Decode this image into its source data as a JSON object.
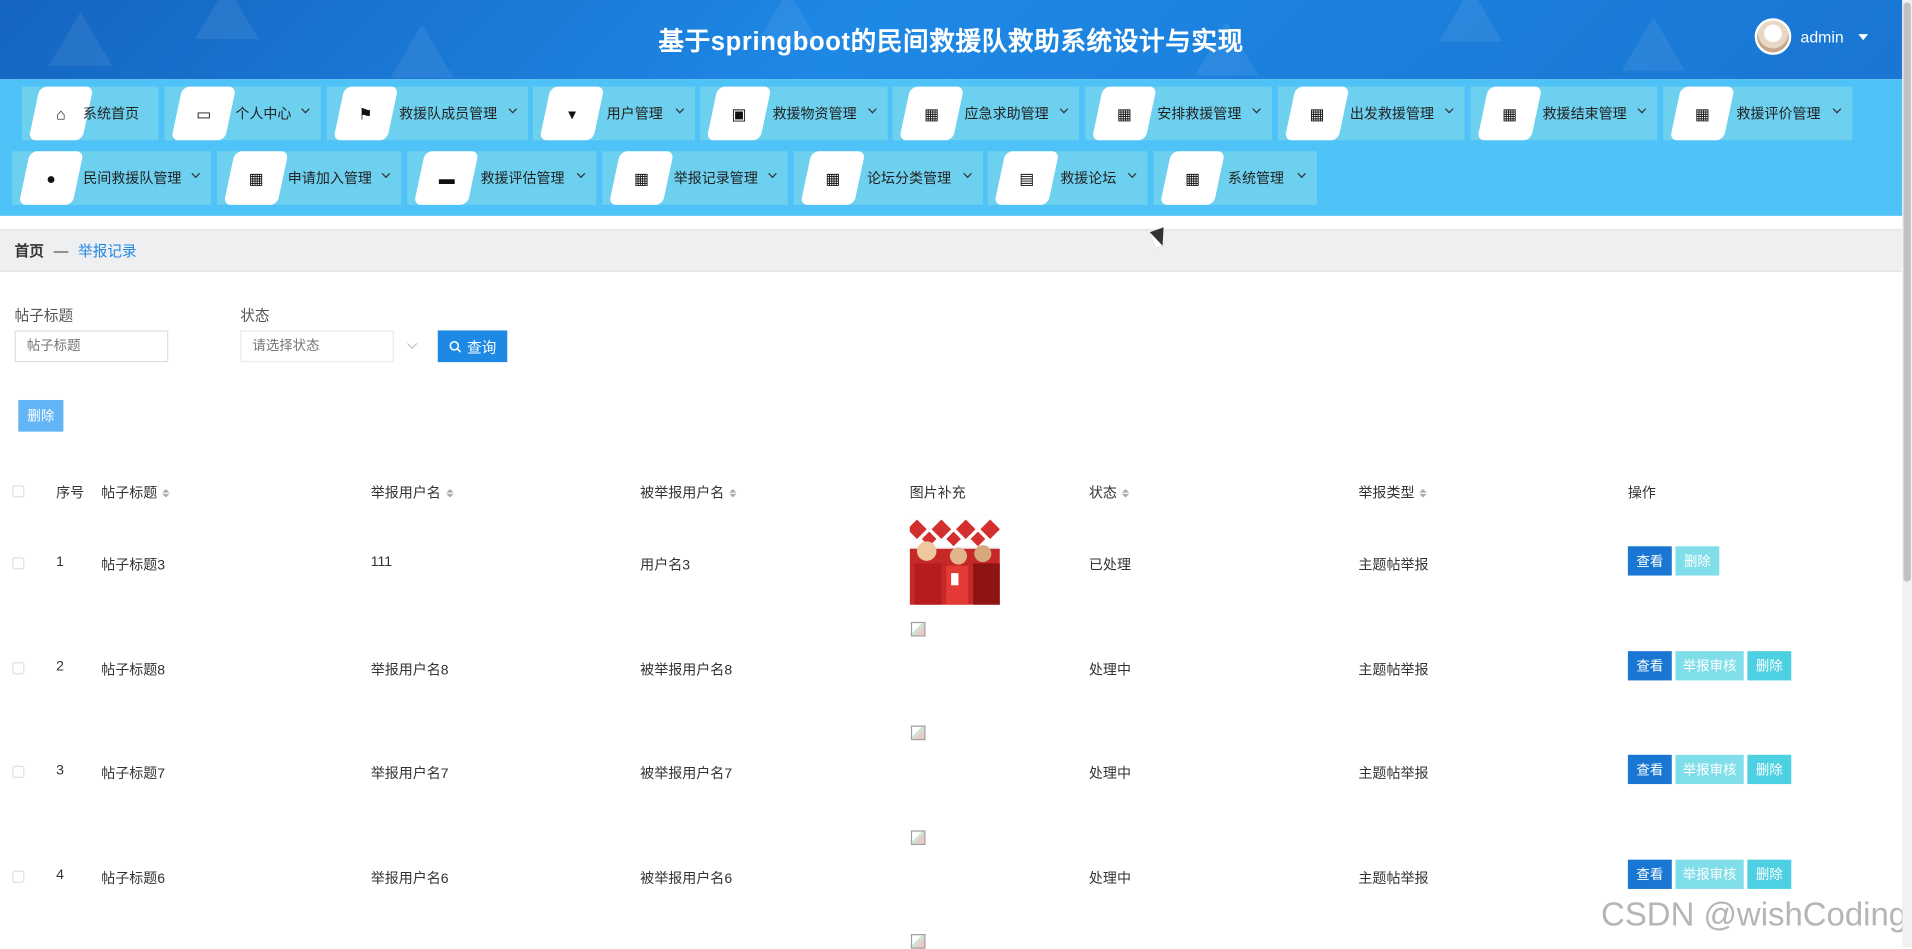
{
  "header": {
    "title": "基于springboot的民间救援队救助系统设计与实现",
    "user": "admin"
  },
  "nav": {
    "row1": [
      {
        "label": "系统首页",
        "icon": "home-icon",
        "glyph": "⌂",
        "dropdown": false
      },
      {
        "label": "个人中心",
        "icon": "card-icon",
        "glyph": "▭",
        "dropdown": true
      },
      {
        "label": "救援队成员管理",
        "icon": "flag-icon",
        "glyph": "⚑",
        "dropdown": true
      },
      {
        "label": "用户管理",
        "icon": "brush-icon",
        "glyph": "▾",
        "dropdown": true
      },
      {
        "label": "救援物资管理",
        "icon": "clipboard-icon",
        "glyph": "▣",
        "dropdown": true
      },
      {
        "label": "应急求助管理",
        "icon": "grid-icon",
        "glyph": "▦",
        "dropdown": true
      },
      {
        "label": "安排救援管理",
        "icon": "grid-icon",
        "glyph": "▦",
        "dropdown": true
      },
      {
        "label": "出发救援管理",
        "icon": "grid-icon",
        "glyph": "▦",
        "dropdown": true
      },
      {
        "label": "救援结束管理",
        "icon": "grid-icon",
        "glyph": "▦",
        "dropdown": true
      },
      {
        "label": "救援评价管理",
        "icon": "grid-icon",
        "glyph": "▦",
        "dropdown": true
      }
    ],
    "row2": [
      {
        "label": "民间救援队管理",
        "icon": "pin-icon",
        "glyph": "●",
        "dropdown": true
      },
      {
        "label": "申请加入管理",
        "icon": "grid-icon",
        "glyph": "▦",
        "dropdown": true
      },
      {
        "label": "救援评估管理",
        "icon": "monitor-icon",
        "glyph": "▬",
        "dropdown": true
      },
      {
        "label": "举报记录管理",
        "icon": "grid-icon",
        "glyph": "▦",
        "dropdown": true
      },
      {
        "label": "论坛分类管理",
        "icon": "grid-icon",
        "glyph": "▦",
        "dropdown": true
      },
      {
        "label": "救援论坛",
        "icon": "briefcase-icon",
        "glyph": "▤",
        "dropdown": true
      },
      {
        "label": "系统管理",
        "icon": "grid-icon",
        "glyph": "▦",
        "dropdown": true
      }
    ]
  },
  "breadcrumb": {
    "home": "首页",
    "sep": "—",
    "current": "举报记录"
  },
  "search": {
    "title_label": "帖子标题",
    "title_placeholder": "帖子标题",
    "status_label": "状态",
    "status_placeholder": "请选择状态",
    "query_button": "查询"
  },
  "actions": {
    "delete_button": "删除"
  },
  "table": {
    "headers": [
      "序号",
      "帖子标题",
      "举报用户名",
      "被举报用户名",
      "图片补充",
      "状态",
      "举报类型",
      "操作"
    ],
    "rows": [
      {
        "index": "1",
        "title": "帖子标题3",
        "reporter": "111",
        "reported": "用户名3",
        "status": "已处理",
        "type": "主题帖举报",
        "has_image": true
      },
      {
        "index": "2",
        "title": "帖子标题8",
        "reporter": "举报用户名8",
        "reported": "被举报用户名8",
        "status": "处理中",
        "type": "主题帖举报",
        "has_image": false
      },
      {
        "index": "3",
        "title": "帖子标题7",
        "reporter": "举报用户名7",
        "reported": "被举报用户名7",
        "status": "处理中",
        "type": "主题帖举报",
        "has_image": false
      },
      {
        "index": "4",
        "title": "帖子标题6",
        "reporter": "举报用户名6",
        "reported": "被举报用户名6",
        "status": "处理中",
        "type": "主题帖举报",
        "has_image": false
      }
    ],
    "row_actions": {
      "view": "查看",
      "audit": "举报审核",
      "delete": "删除"
    }
  },
  "watermark": "CSDN @wishCoding",
  "colors": {
    "header": "#1976d2",
    "nav": "#4fc3f7",
    "primary": "#1e88e5"
  }
}
